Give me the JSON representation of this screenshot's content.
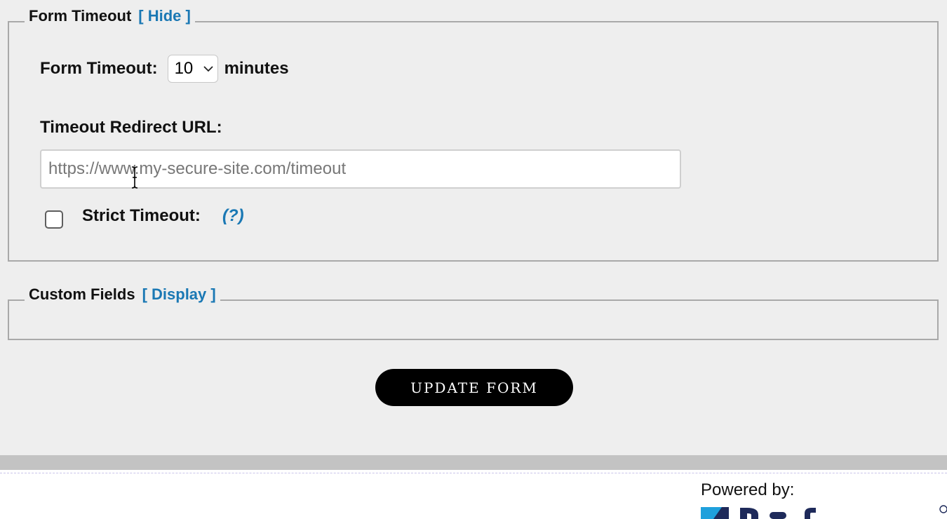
{
  "form_timeout_section": {
    "legend_title": "Form Timeout",
    "toggle_label": "[ Hide ]",
    "timeout_label": "Form Timeout:",
    "timeout_value": "10",
    "timeout_unit": "minutes",
    "redirect_label": "Timeout Redirect URL:",
    "redirect_placeholder": "https://www.my-secure-site.com/timeout",
    "strict_label": "Strict Timeout:",
    "strict_checked": false,
    "help_link": "(?)"
  },
  "custom_fields_section": {
    "legend_title": "Custom Fields",
    "toggle_label": "[ Display ]"
  },
  "update_button_label": "UPDATE FORM",
  "footer": {
    "powered_by": "Powered by:"
  },
  "colors": {
    "link": "#1a78b4",
    "background": "#eeeeee",
    "button": "#000000",
    "logo_blue": "#1fa0dc",
    "logo_navy": "#1e2a5a"
  }
}
